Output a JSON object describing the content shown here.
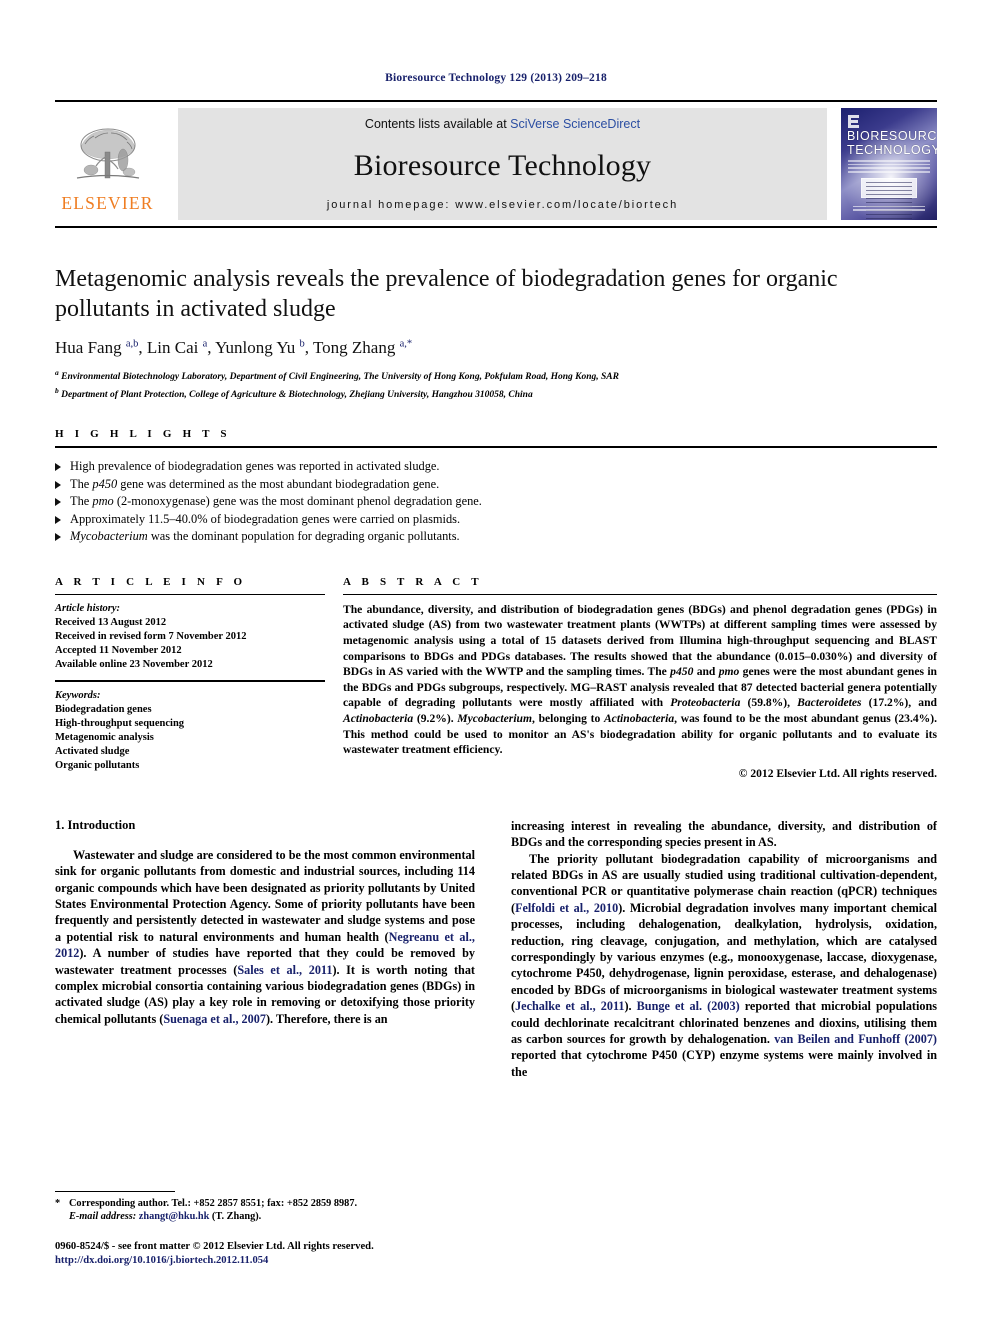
{
  "running_head": "Bioresource Technology 129 (2013) 209–218",
  "masthead": {
    "publisher_logo_word": "ELSEVIER",
    "contents_prefix": "Contents lists available at ",
    "contents_link": "SciVerse ScienceDirect",
    "journal_title": "Bioresource Technology",
    "homepage": "journal homepage: www.elsevier.com/locate/biortech",
    "cover_title_line1": "BIORESOURCE",
    "cover_title_line2": "TECHNOLOGY"
  },
  "article": {
    "title": "Metagenomic analysis reveals the prevalence of biodegradation genes for organic pollutants in activated sludge",
    "authors_html": "Hua Fang <sup>a,b</sup>, Lin Cai <sup>a</sup>, Yunlong Yu <sup>b</sup>, Tong Zhang <sup>a,*</sup>",
    "affiliation_a": "Environmental Biotechnology Laboratory, Department of Civil Engineering, The University of Hong Kong, Pokfulam Road, Hong Kong, SAR",
    "affiliation_b": "Department of Plant Protection, College of Agriculture & Biotechnology, Zhejiang University, Hangzhou 310058, China",
    "affiliation_a_marker": "a",
    "affiliation_b_marker": "b"
  },
  "highlights": {
    "heading": "H I G H L I G H T S",
    "items_html": [
      "High prevalence of biodegradation genes was reported in activated sludge.",
      "The <em>p450</em> gene was determined as the most abundant biodegradation gene.",
      "The <em>pmo</em> (2-monoxygenase) gene was the most dominant phenol degradation gene.",
      "Approximately 11.5–40.0% of biodegradation genes were carried on plasmids.",
      "<em>Mycobacterium</em> was the dominant population for degrading organic pollutants."
    ]
  },
  "article_info": {
    "heading": "A R T I C L E    I N F O",
    "history_label": "Article history:",
    "history": [
      "Received 13 August 2012",
      "Received in revised form 7 November 2012",
      "Accepted 11 November 2012",
      "Available online 23 November 2012"
    ],
    "keywords_label": "Keywords:",
    "keywords": [
      "Biodegradation genes",
      "High-throughput sequencing",
      "Metagenomic analysis",
      "Activated sludge",
      "Organic pollutants"
    ]
  },
  "abstract": {
    "heading": "A B S T R A C T",
    "text_html": "The abundance, diversity, and distribution of biodegradation genes (BDGs) and phenol degradation genes (PDGs) in activated sludge (AS) from two wastewater treatment plants (WWTPs) at different sampling times were assessed by metagenomic analysis using a total of 15 datasets derived from Illumina high-throughput sequencing and BLAST comparisons to BDGs and PDGs databases. The results showed that the abundance (0.015–0.030%) and diversity of BDGs in AS varied with the WWTP and the sampling times. The <i>p450</i> and <i>pmo</i> genes were the most abundant genes in the BDGs and PDGs subgroups, respectively. MG–RAST analysis revealed that 87 detected bacterial genera potentially capable of degrading pollutants were mostly affiliated with <i>Proteobacteria</i> (59.8%), <i>Bacteroidetes</i> (17.2%), and <i>Actinobacteria</i> (9.2%). <i>Mycobacterium</i>, belonging to <i>Actinobacteria</i>, was found to be the most abundant genus (23.4%). This method could be used to monitor an AS's biodegradation ability for organic pollutants and to evaluate its wastewater treatment efficiency.",
    "copyright": "© 2012 Elsevier Ltd. All rights reserved."
  },
  "body": {
    "section_heading": "1. Introduction",
    "left_paragraph_html": "Wastewater and sludge are considered to be the most common environmental sink for organic pollutants from domestic and industrial sources, including 114 organic compounds which have been designated as priority pollutants by United States Environmental Protection Agency. Some of priority pollutants have been frequently and persistently detected in wastewater and sludge systems and pose a potential risk to natural environments and human health (<span class=\"cite\">Negreanu et al., 2012</span>). A number of studies have reported that they could be removed by wastewater treatment processes (<span class=\"cite\">Sales et al., 2011</span>). It is worth noting that complex microbial consortia containing various biodegradation genes (BDGs) in activated sludge (AS) play a key role in removing or detoxifying those priority chemical pollutants (<span class=\"cite\">Suenaga et al., 2007</span>). Therefore, there is an",
    "right_paragraph1_html": "increasing interest in revealing the abundance, diversity, and distribution of BDGs and the corresponding species present in AS.",
    "right_paragraph2_html": "The priority pollutant biodegradation capability of microorganisms and related BDGs in AS are usually studied using traditional cultivation-dependent, conventional PCR or quantitative polymerase chain reaction (qPCR) techniques (<span class=\"cite\">Felfoldi et al., 2010</span>). Microbial degradation involves many important chemical processes, including dehalogenation, dealkylation, hydrolysis, oxidation, reduction, ring cleavage, conjugation, and methylation, which are catalysed correspondingly by various enzymes (e.g., monooxygenase, laccase, dioxygenase, cytochrome P450, dehydrogenase, lignin peroxidase, esterase, and dehalogenase) encoded by BDGs of microorganisms in biological wastewater treatment systems (<span class=\"cite\">Jechalke et al., 2011</span>). <span class=\"cite\">Bunge et al. (2003)</span> reported that microbial populations could dechlorinate recalcitrant chlorinated benzenes and dioxins, utilising them as carbon sources for growth by dehalogenation. <span class=\"cite\">van Beilen and Funhoff (2007)</span> reported that cytochrome P450 (CYP) enzyme systems were mainly involved in the"
  },
  "footnote": {
    "corresponding_html": "Corresponding author. Tel.: +852 2857 8551; fax: +852 2859 8987.",
    "email_label": "E-mail address:",
    "email": "zhangt@hku.hk",
    "email_owner": "(T. Zhang).",
    "star": "*"
  },
  "footer": {
    "issn_line": "0960-8524/$ - see front matter © 2012 Elsevier Ltd. All rights reserved.",
    "doi_line": "http://dx.doi.org/10.1016/j.biortech.2012.11.054"
  },
  "colors": {
    "running_head": "#18216b",
    "citation": "#18216b",
    "elsevier_orange": "#ef7d22",
    "band_gray": "#e3e3e3",
    "sciencedirect_link": "#2b4ea2"
  }
}
